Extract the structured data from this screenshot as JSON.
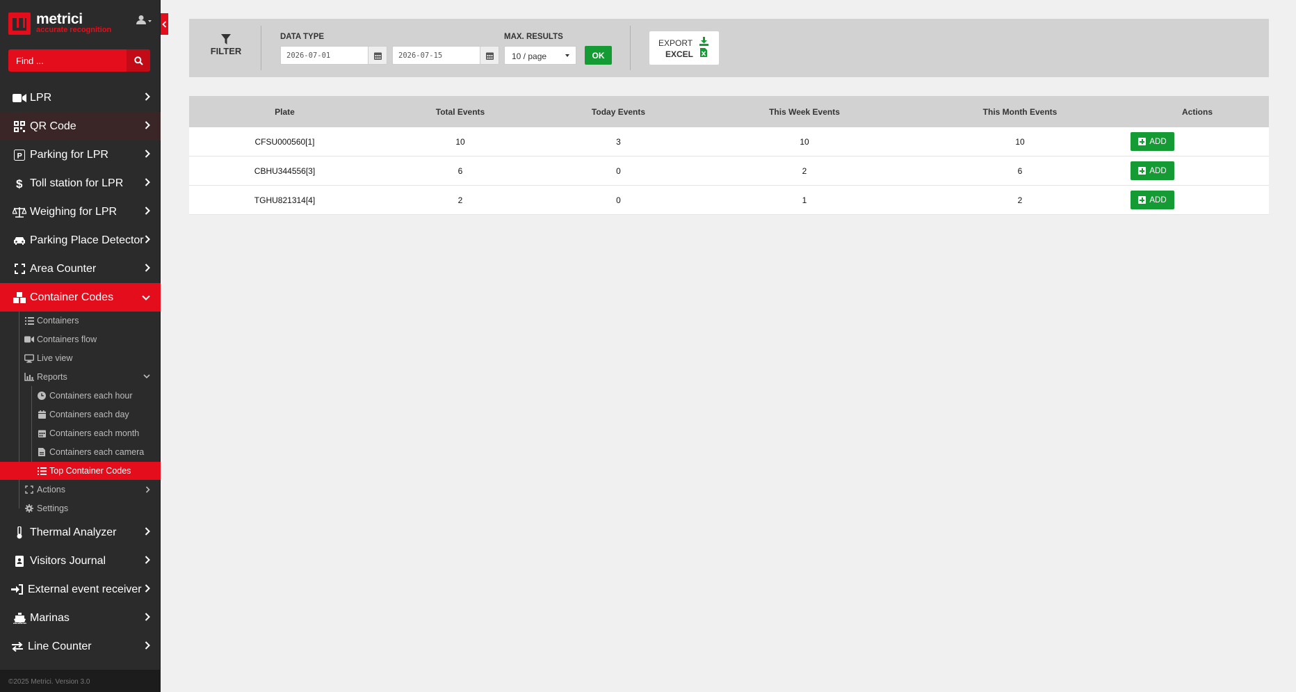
{
  "brand": {
    "name": "metrici",
    "tagline": "accurate recognition"
  },
  "search": {
    "placeholder": "Find ..."
  },
  "menu": [
    {
      "label": "LPR",
      "icon": "video-camera-icon"
    },
    {
      "label": "QR Code",
      "icon": "qrcode-icon"
    },
    {
      "label": "Parking for LPR",
      "icon": "parking-icon"
    },
    {
      "label": "Toll station for LPR",
      "icon": "dollar-icon"
    },
    {
      "label": "Weighing for LPR",
      "icon": "balance-scale-icon"
    },
    {
      "label": "Parking Place Detector",
      "icon": "car-icon"
    },
    {
      "label": "Area Counter",
      "icon": "expand-icon"
    },
    {
      "label": "Container Codes",
      "icon": "cubes-icon",
      "expanded": true
    },
    {
      "label": "Thermal Analyzer",
      "icon": "thermometer-icon"
    },
    {
      "label": "Visitors Journal",
      "icon": "id-badge-icon"
    },
    {
      "label": "External event receiver",
      "icon": "sign-in-icon"
    },
    {
      "label": "Marinas",
      "icon": "ship-icon"
    },
    {
      "label": "Line Counter",
      "icon": "exchange-icon"
    }
  ],
  "container_submenu": [
    {
      "label": "Containers",
      "icon": "list-icon"
    },
    {
      "label": "Containers flow",
      "icon": "video-camera-icon"
    },
    {
      "label": "Live view",
      "icon": "desktop-icon"
    },
    {
      "label": "Reports",
      "icon": "area-chart-icon",
      "expanded": true
    },
    {
      "label": "Actions",
      "icon": "arrows-icon"
    },
    {
      "label": "Settings",
      "icon": "gear-icon"
    }
  ],
  "reports_submenu": [
    {
      "label": "Containers each hour",
      "icon": "clock-icon"
    },
    {
      "label": "Containers each day",
      "icon": "calendar-icon"
    },
    {
      "label": "Containers each month",
      "icon": "calendar-month-icon"
    },
    {
      "label": "Containers each camera",
      "icon": "file-icon"
    },
    {
      "label": "Top Container Codes",
      "icon": "list-ol-icon",
      "active": true
    }
  ],
  "footer": "©2025 Metrici. Version 3.0",
  "filter": {
    "title": "FILTER",
    "data_type_label": "DATA TYPE",
    "date_from": "2026-07-01",
    "date_to": "2026-07-15",
    "max_results_label": "MAX. RESULTS",
    "max_results_value": "10 / page",
    "ok_label": "OK",
    "export_line1": "EXPORT",
    "export_line2": "EXCEL"
  },
  "table": {
    "headers": [
      "Plate",
      "Total Events",
      "Today Events",
      "This Week Events",
      "This Month Events",
      "Actions"
    ],
    "add_label": "ADD",
    "rows": [
      {
        "plate": "CFSU000560[1]",
        "total": "10",
        "today": "3",
        "week": "10",
        "month": "10"
      },
      {
        "plate": "CBHU344556[3]",
        "total": "6",
        "today": "0",
        "week": "2",
        "month": "6"
      },
      {
        "plate": "TGHU821314[4]",
        "total": "2",
        "today": "0",
        "week": "1",
        "month": "2"
      }
    ]
  },
  "colors": {
    "accent": "#e30d1b",
    "sidebar_bg": "#2b2b2b",
    "success": "#159b33",
    "panel_bg": "#d2d2d2"
  }
}
